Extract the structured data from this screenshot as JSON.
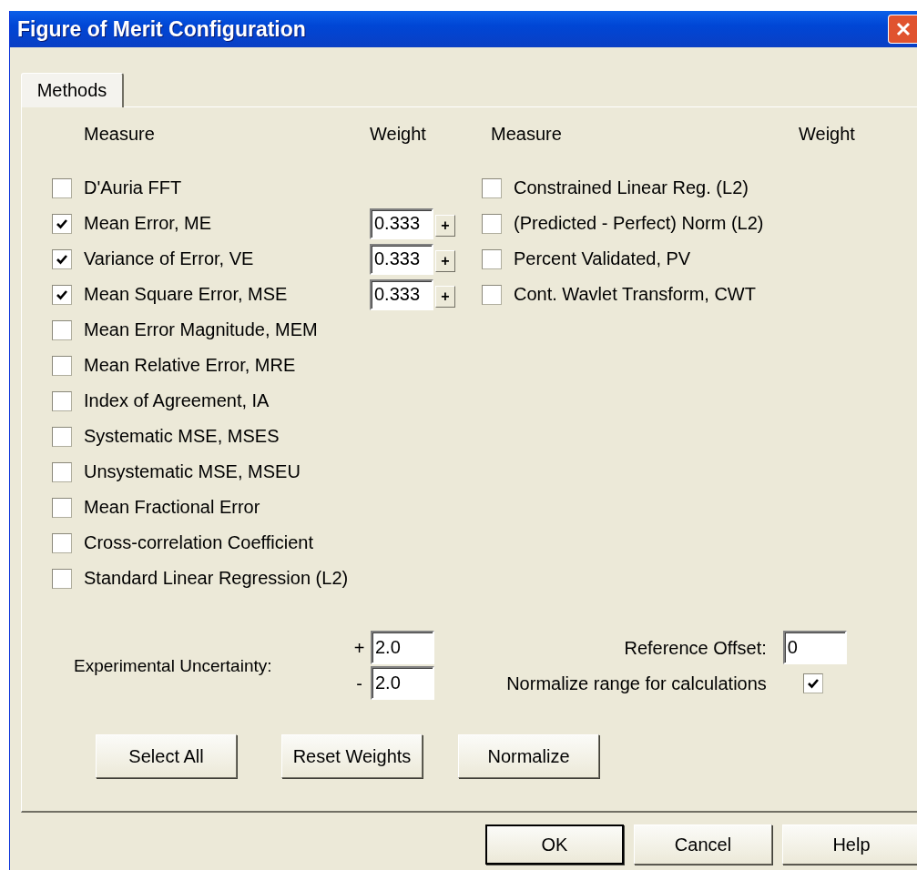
{
  "window": {
    "title": "Figure of Merit Configuration"
  },
  "tabs": [
    {
      "label": "Methods",
      "selected": true
    }
  ],
  "headers": [
    "Measure",
    "Weight",
    "Measure",
    "Weight"
  ],
  "measures_left": [
    {
      "label": "D'Auria FFT",
      "checked": false
    },
    {
      "label": "Mean Error, ME",
      "checked": true,
      "weight": "0.333",
      "step": "+"
    },
    {
      "label": "Variance of Error, VE",
      "checked": true,
      "weight": "0.333",
      "step": "+"
    },
    {
      "label": "Mean Square Error, MSE",
      "checked": true,
      "weight": "0.333",
      "step": "+"
    },
    {
      "label": "Mean Error Magnitude, MEM",
      "checked": false
    },
    {
      "label": "Mean Relative Error, MRE",
      "checked": false
    },
    {
      "label": "Index of Agreement, IA",
      "checked": false
    },
    {
      "label": "Systematic MSE, MSES",
      "checked": false
    },
    {
      "label": "Unsystematic MSE, MSEU",
      "checked": false
    },
    {
      "label": "Mean Fractional Error",
      "checked": false
    },
    {
      "label": "Cross-correlation Coefficient",
      "checked": false
    },
    {
      "label": "Standard Linear Regression (L2)",
      "checked": false
    }
  ],
  "measures_right": [
    {
      "label": "Constrained Linear Reg. (L2)",
      "checked": false
    },
    {
      "label": "(Predicted - Perfect) Norm (L2)",
      "checked": false
    },
    {
      "label": "Percent Validated, PV",
      "checked": false
    },
    {
      "label": "Cont. Wavlet Transform, CWT",
      "checked": false
    }
  ],
  "uncertainty": {
    "label": "Experimental Uncertainty:",
    "plus_sign": "+",
    "plus_value": "2.0",
    "minus_sign": "-",
    "minus_value": "2.0"
  },
  "reference_offset": {
    "label": "Reference Offset:",
    "value": "0"
  },
  "normalize_range": {
    "label": "Normalize range for calculations",
    "checked": true
  },
  "action_buttons": [
    "Select All",
    "Reset Weights",
    "Normalize"
  ],
  "dialog_buttons": [
    {
      "label": "OK",
      "default": true
    },
    {
      "label": "Cancel",
      "default": false
    },
    {
      "label": "Help",
      "default": false
    }
  ]
}
